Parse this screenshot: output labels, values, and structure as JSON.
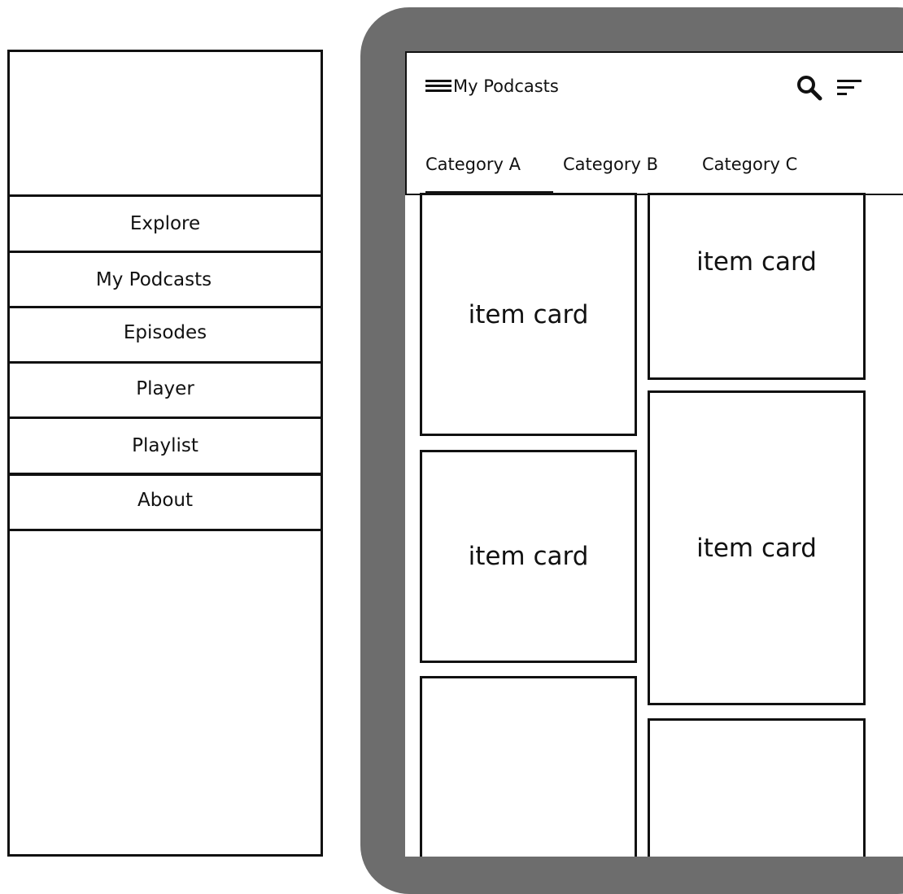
{
  "drawer": {
    "items": [
      {
        "label": "Explore"
      },
      {
        "label": "My Podcasts"
      },
      {
        "label": "Episodes"
      },
      {
        "label": "Player"
      },
      {
        "label": "Playlist"
      },
      {
        "label": "About"
      }
    ]
  },
  "appbar": {
    "title": "My Podcasts",
    "icons": [
      "menu-icon",
      "search-icon",
      "sort-icon"
    ]
  },
  "tabs": [
    {
      "label": "Category A",
      "selected": true
    },
    {
      "label": "Category B",
      "selected": false
    },
    {
      "label": "Category C",
      "selected": false
    }
  ],
  "cards": [
    {
      "label": "item card"
    },
    {
      "label": "item card"
    },
    {
      "label": "item card"
    },
    {
      "label": "item card"
    },
    {
      "label": ""
    },
    {
      "label": ""
    }
  ],
  "colors": {
    "frame": "#6d6d6d",
    "stroke": "#111111",
    "background": "#ffffff"
  }
}
